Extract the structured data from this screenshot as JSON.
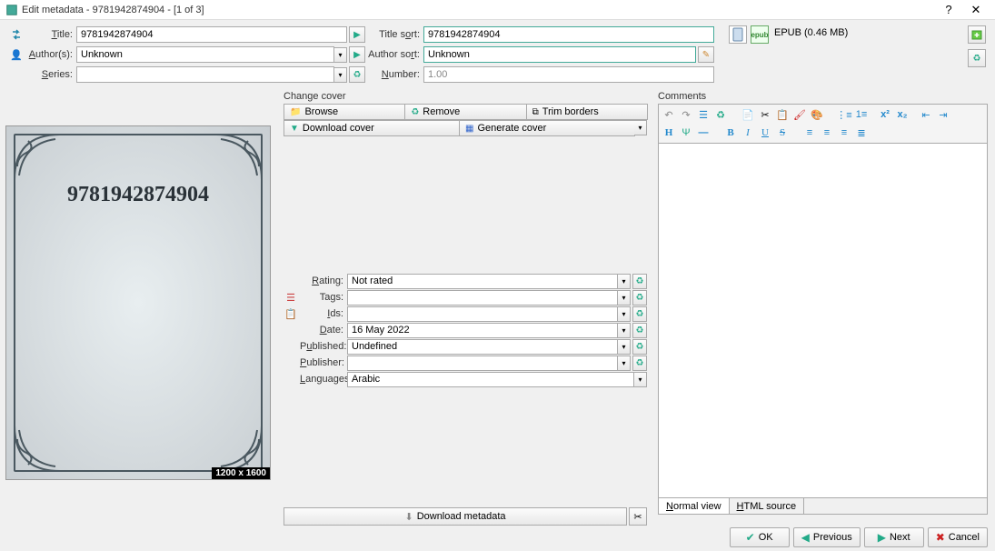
{
  "window": {
    "title": "Edit metadata - 9781942874904 -  [1 of 3]"
  },
  "title_field": {
    "label": "Title:",
    "value": "9781942874904"
  },
  "author_field": {
    "label": "Author(s):",
    "value": "Unknown"
  },
  "series_field": {
    "label": "Series:",
    "value": ""
  },
  "title_sort": {
    "label": "Title sort:",
    "value": "9781942874904"
  },
  "author_sort": {
    "label": "Author sort:",
    "value": "Unknown"
  },
  "number": {
    "label": "Number:",
    "value": "1.00"
  },
  "formats": {
    "label": "EPUB (0.46 MB)"
  },
  "change_cover": {
    "title": "Change cover",
    "browse": "Browse",
    "remove": "Remove",
    "trim": "Trim borders",
    "download": "Download cover",
    "generate": "Generate cover"
  },
  "cover": {
    "text": "9781942874904",
    "size": "1200 x 1600"
  },
  "meta": {
    "rating": {
      "label": "Rating:",
      "value": "Not rated"
    },
    "tags": {
      "label": "Tags:",
      "value": ""
    },
    "ids": {
      "label": "Ids:",
      "value": ""
    },
    "date": {
      "label": "Date:",
      "value": "16 May 2022"
    },
    "published": {
      "label": "Published:",
      "value": "Undefined"
    },
    "publisher": {
      "label": "Publisher:",
      "value": ""
    },
    "languages": {
      "label": "Languages:",
      "value": "Arabic"
    }
  },
  "dl_meta": "Download metadata",
  "comments": {
    "title": "Comments",
    "tabs": {
      "normal": "Normal view",
      "html": "HTML source"
    }
  },
  "footer": {
    "ok": "OK",
    "previous": "Previous",
    "next": "Next",
    "cancel": "Cancel"
  }
}
